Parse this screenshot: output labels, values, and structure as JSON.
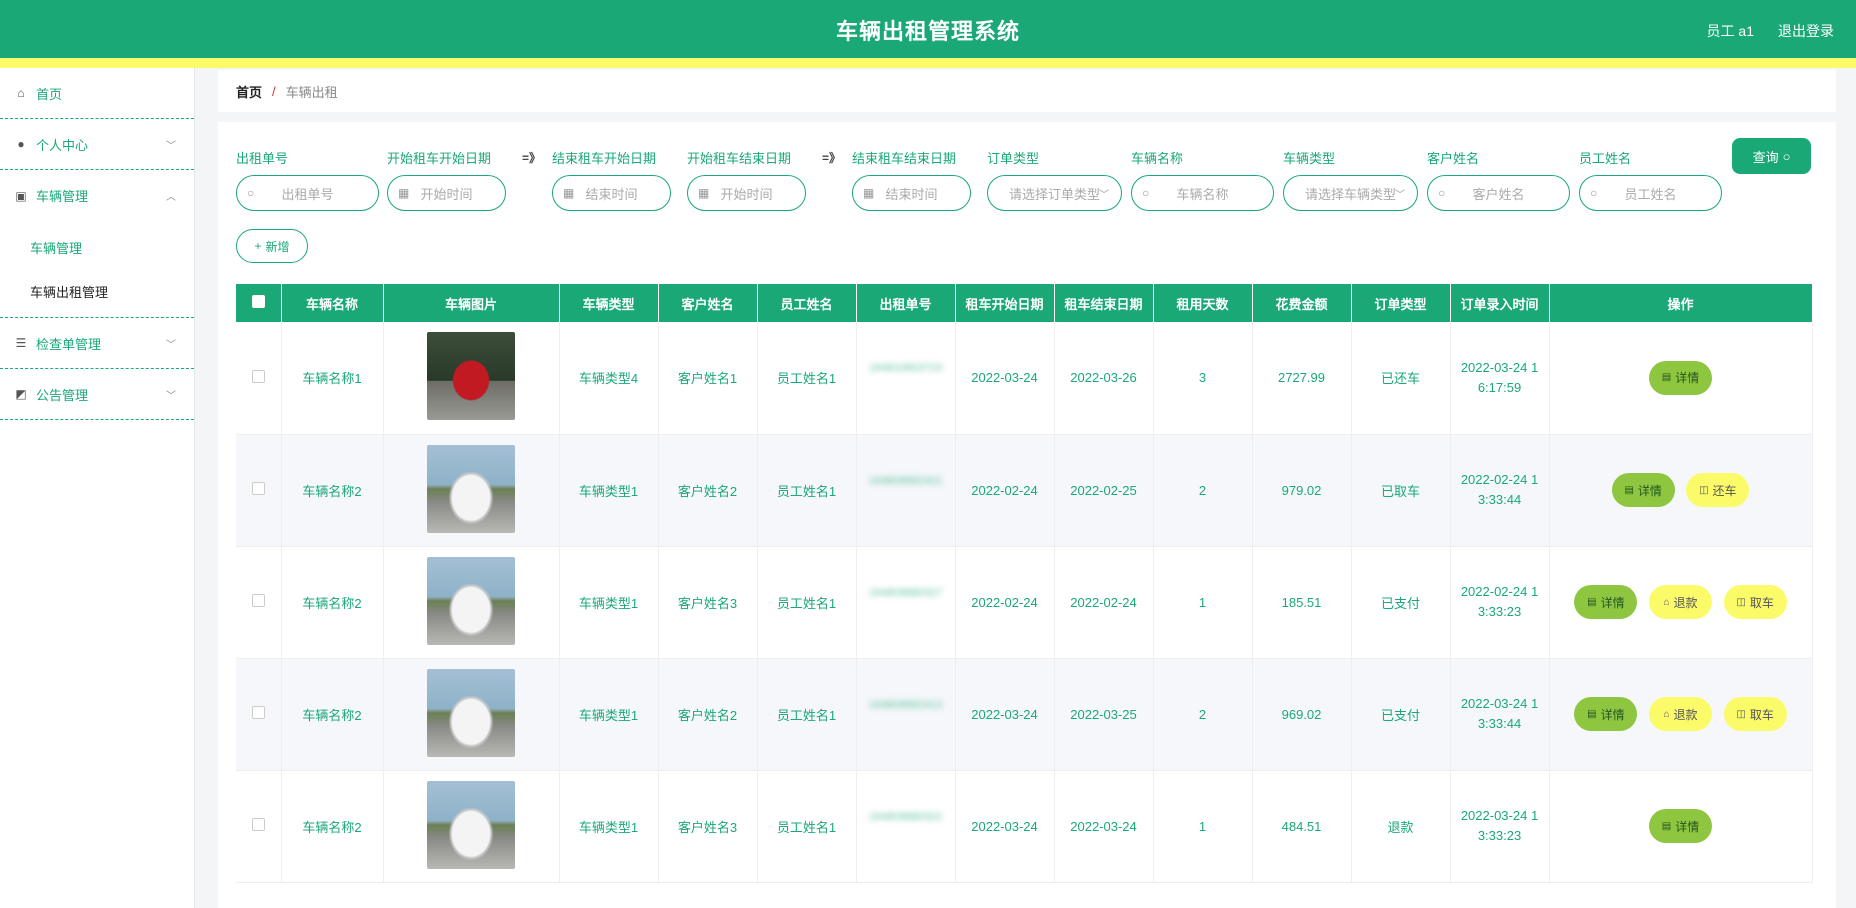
{
  "header": {
    "title": "车辆出租管理系统",
    "user": "员工 a1",
    "logout": "退出登录"
  },
  "sidebar": {
    "items": [
      {
        "label": "首页",
        "icon": "home-icon"
      },
      {
        "label": "个人中心",
        "icon": "user-icon"
      },
      {
        "label": "车辆管理",
        "icon": "car-icon",
        "children": [
          "车辆管理",
          "车辆出租管理"
        ]
      },
      {
        "label": "检查单管理",
        "icon": "list-icon"
      },
      {
        "label": "公告管理",
        "icon": "chart-icon"
      }
    ]
  },
  "breadcrumb": {
    "home": "首页",
    "sep": "/",
    "current": "车辆出租"
  },
  "filters": [
    {
      "label": "出租单号",
      "placeholder": "出租单号"
    },
    {
      "label": "开始租车开始日期",
      "placeholder": "开始时间"
    },
    {
      "label": "结束租车开始日期",
      "placeholder": "结束时间"
    },
    {
      "label": "开始租车结束日期",
      "placeholder": "开始时间"
    },
    {
      "label": "结束租车结束日期",
      "placeholder": "结束时间"
    },
    {
      "label": "订单类型",
      "placeholder": "请选择订单类型"
    },
    {
      "label": "车辆名称",
      "placeholder": "车辆名称"
    },
    {
      "label": "车辆类型",
      "placeholder": "请选择车辆类型"
    },
    {
      "label": "客户姓名",
      "placeholder": "客户姓名"
    },
    {
      "label": "员工姓名",
      "placeholder": "员工姓名"
    }
  ],
  "range_arrow": "=》",
  "buttons": {
    "query": "查询",
    "add": "新增"
  },
  "table": {
    "headers": [
      "车辆名称",
      "车辆图片",
      "车辆类型",
      "客户姓名",
      "员工姓名",
      "出租单号",
      "租车开始日期",
      "租车结束日期",
      "租用天数",
      "花费金额",
      "订单类型",
      "订单录入时间",
      "操作"
    ],
    "rows": [
      {
        "name": "车辆名称1",
        "car": "red",
        "type": "车辆类型4",
        "customer": "客户姓名1",
        "staff": "员工姓名1",
        "order_no": "164810803723",
        "start": "2022-03-24",
        "end": "2022-03-26",
        "days": "3",
        "cost": "2727.99",
        "status": "已还车",
        "time1": "2022-03-24 1",
        "time2": "6:17:59",
        "actions": [
          {
            "label": "详情",
            "style": "green"
          }
        ]
      },
      {
        "name": "车辆名称2",
        "car": "white",
        "type": "车辆类型1",
        "customer": "客户姓名2",
        "staff": "员工姓名1",
        "order_no": "164809882421",
        "start": "2022-02-24",
        "end": "2022-02-25",
        "days": "2",
        "cost": "979.02",
        "status": "已取车",
        "time1": "2022-02-24 1",
        "time2": "3:33:44",
        "actions": [
          {
            "label": "详情",
            "style": "green"
          },
          {
            "label": "还车",
            "style": "yellow"
          }
        ]
      },
      {
        "name": "车辆名称2",
        "car": "white",
        "type": "车辆类型1",
        "customer": "客户姓名3",
        "staff": "员工姓名1",
        "order_no": "164809880327",
        "start": "2022-02-24",
        "end": "2022-02-24",
        "days": "1",
        "cost": "185.51",
        "status": "已支付",
        "time1": "2022-02-24 1",
        "time2": "3:33:23",
        "actions": [
          {
            "label": "详情",
            "style": "green"
          },
          {
            "label": "退款",
            "style": "yellow"
          },
          {
            "label": "取车",
            "style": "yellow"
          }
        ]
      },
      {
        "name": "车辆名称2",
        "car": "white",
        "type": "车辆类型1",
        "customer": "客户姓名2",
        "staff": "员工姓名1",
        "order_no": "164809882413",
        "start": "2022-03-24",
        "end": "2022-03-25",
        "days": "2",
        "cost": "969.02",
        "status": "已支付",
        "time1": "2022-03-24 1",
        "time2": "3:33:44",
        "actions": [
          {
            "label": "详情",
            "style": "green"
          },
          {
            "label": "退款",
            "style": "yellow"
          },
          {
            "label": "取车",
            "style": "yellow"
          }
        ]
      },
      {
        "name": "车辆名称2",
        "car": "white",
        "type": "车辆类型1",
        "customer": "客户姓名3",
        "staff": "员工姓名1",
        "order_no": "164809880322",
        "start": "2022-03-24",
        "end": "2022-03-24",
        "days": "1",
        "cost": "484.51",
        "status": "退款",
        "time1": "2022-03-24 1",
        "time2": "3:33:23",
        "actions": [
          {
            "label": "详情",
            "style": "green"
          }
        ]
      }
    ]
  },
  "colors": {
    "primary": "#1aa877",
    "accent_yellow": "#fbfb6a",
    "action_green": "#8ec63f"
  }
}
